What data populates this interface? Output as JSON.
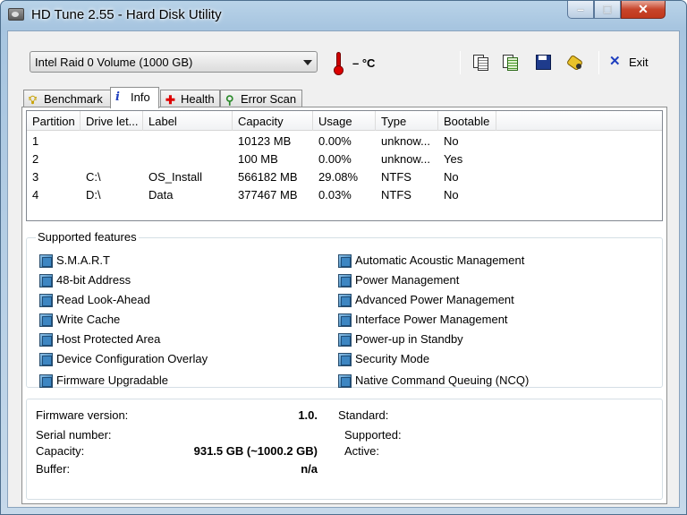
{
  "window": {
    "title": "HD Tune 2.55 - Hard Disk Utility",
    "min_label": "–",
    "max_label": "□",
    "close_label": "✕"
  },
  "toolbar": {
    "drive_selected": "Intel   Raid 0 Volume (1000 GB)",
    "temperature": "– °C",
    "exit_label": "Exit",
    "icons": [
      "copy-text-icon",
      "copy-screenshot-icon",
      "save-icon",
      "options-icon",
      "exit-icon"
    ]
  },
  "tabs": [
    {
      "label": "Benchmark",
      "icon": "lightbulb-icon",
      "active": false
    },
    {
      "label": "Info",
      "icon": "info-icon",
      "active": true
    },
    {
      "label": "Health",
      "icon": "health-cross-icon",
      "active": false
    },
    {
      "label": "Error Scan",
      "icon": "magnifier-icon",
      "active": false
    }
  ],
  "partitions": {
    "columns": [
      "Partition",
      "Drive let...",
      "Label",
      "Capacity",
      "Usage",
      "Type",
      "Bootable"
    ],
    "rows": [
      [
        "1",
        "",
        "",
        "10123 MB",
        "0.00%",
        "unknow...",
        "No"
      ],
      [
        "2",
        "",
        "",
        "100 MB",
        "0.00%",
        "unknow...",
        "Yes"
      ],
      [
        "3",
        "C:\\",
        "OS_Install",
        "566182 MB",
        "29.08%",
        "NTFS",
        "No"
      ],
      [
        "4",
        "D:\\",
        "Data",
        "377467 MB",
        "0.03%",
        "NTFS",
        "No"
      ]
    ]
  },
  "features": {
    "title": "Supported features",
    "left": [
      "S.M.A.R.T",
      "48-bit Address",
      "Read Look-Ahead",
      "Write Cache",
      "Host Protected Area",
      "Device Configuration Overlay",
      "Firmware Upgradable"
    ],
    "right": [
      "Automatic Acoustic Management",
      "Power Management",
      "Advanced Power Management",
      "Interface Power Management",
      "Power-up in Standby",
      "Security Mode",
      "Native Command Queuing (NCQ)"
    ]
  },
  "details": {
    "firmware_label": "Firmware version:",
    "firmware_value": "1.0.",
    "serial_label": "Serial number:",
    "serial_value": "",
    "capacity_label": "Capacity:",
    "capacity_value": "931.5 GB (~1000.2 GB)",
    "buffer_label": "Buffer:",
    "buffer_value": "n/a",
    "standard_label": "Standard:",
    "supported_label": "Supported:",
    "active_label": "Active:"
  }
}
